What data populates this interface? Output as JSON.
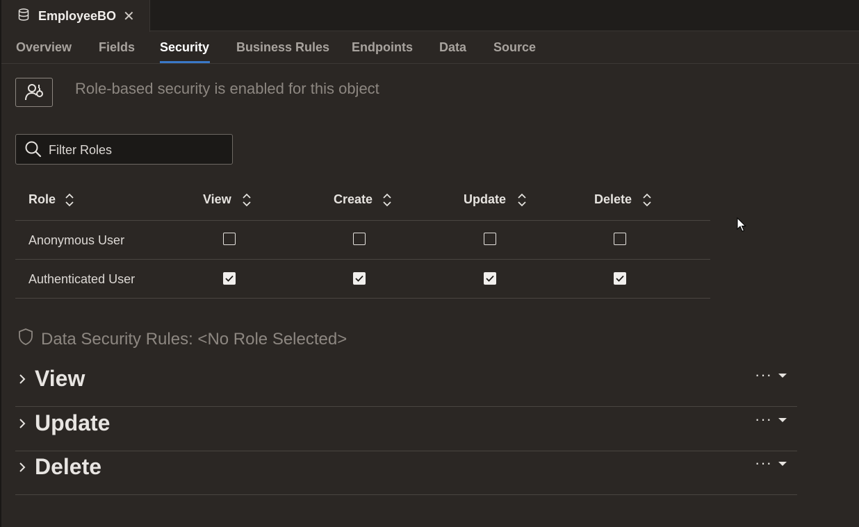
{
  "document_tab": {
    "title": "EmployeeBO",
    "close_glyph": "✕",
    "icon": "database-icon"
  },
  "subnav": {
    "tabs": [
      {
        "label": "Overview",
        "active": false
      },
      {
        "label": "Fields",
        "active": false
      },
      {
        "label": "Security",
        "active": true
      },
      {
        "label": "Business Rules",
        "active": false
      },
      {
        "label": "Endpoints",
        "active": false
      },
      {
        "label": "Data",
        "active": false
      },
      {
        "label": "Source",
        "active": false
      }
    ]
  },
  "role_security": {
    "message": "Role-based security is enabled for this object",
    "icon": "user-security-icon"
  },
  "filter": {
    "placeholder": "Filter Roles",
    "value": ""
  },
  "table": {
    "columns": [
      "Role",
      "View",
      "Create",
      "Update",
      "Delete"
    ],
    "rows": [
      {
        "role": "Anonymous User",
        "view": false,
        "create": false,
        "update": false,
        "delete": false
      },
      {
        "role": "Authenticated User",
        "view": true,
        "create": true,
        "update": true,
        "delete": true
      }
    ]
  },
  "data_security": {
    "title": "Data Security Rules: <No Role Selected>",
    "sections": [
      {
        "label": "View",
        "more": "···"
      },
      {
        "label": "Update",
        "more": "···"
      },
      {
        "label": "Delete",
        "more": "···"
      }
    ]
  },
  "colors": {
    "accent": "#3a78c8",
    "background": "#2b2724",
    "muted_text": "#8d8781"
  }
}
